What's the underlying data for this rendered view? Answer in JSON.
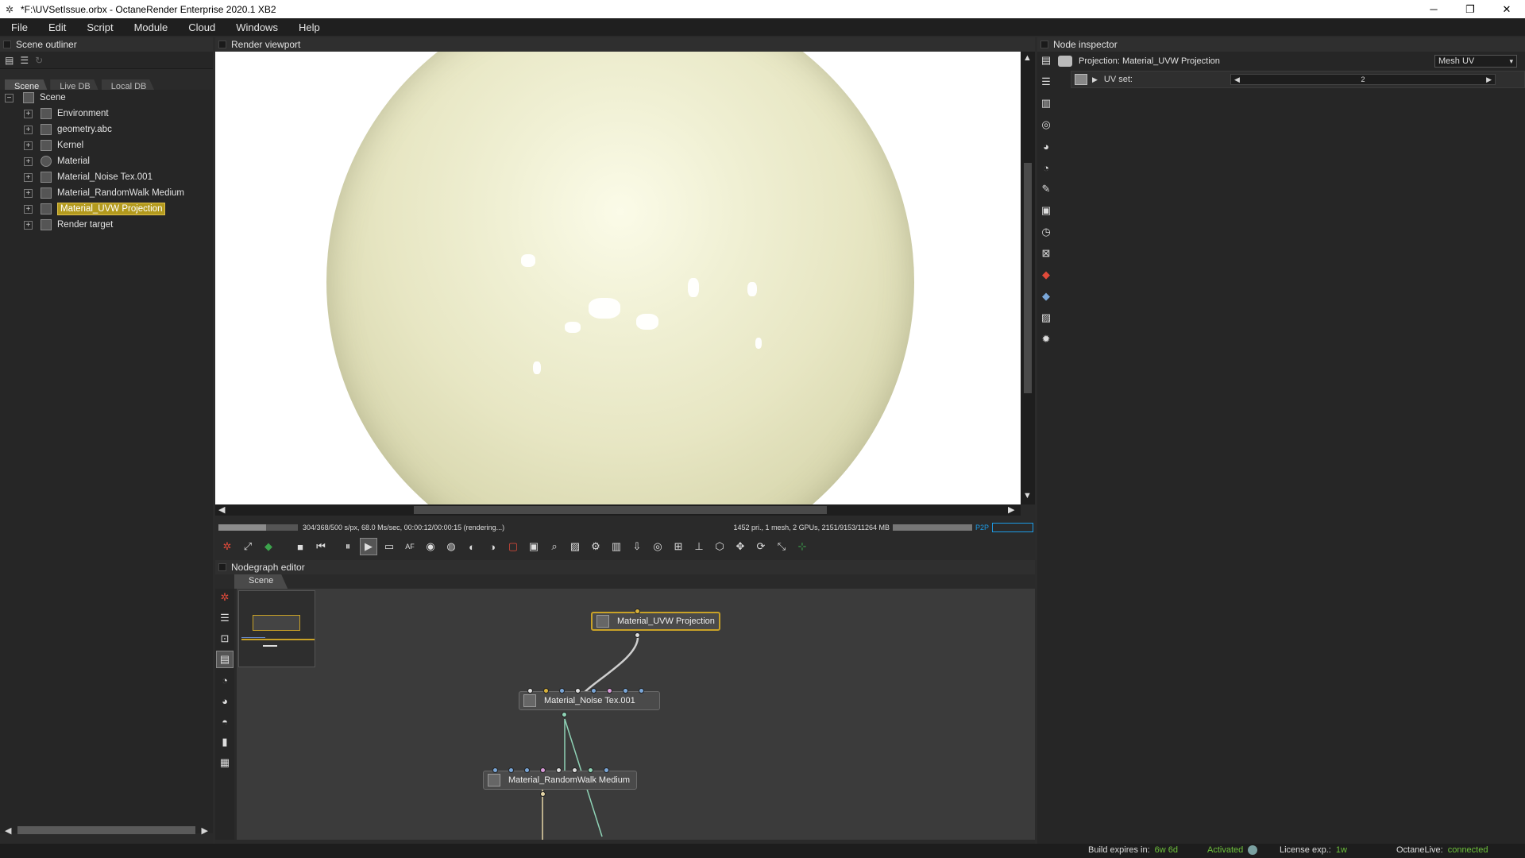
{
  "window": {
    "title": "*F:\\UVSetIssue.orbx - OctaneRender Enterprise 2020.1 XB2",
    "controls": [
      "minimize",
      "restore",
      "close"
    ]
  },
  "menu": [
    "File",
    "Edit",
    "Script",
    "Module",
    "Cloud",
    "Windows",
    "Help"
  ],
  "scene_outliner": {
    "header": "Scene outliner",
    "tabs": [
      "Scene",
      "Live DB",
      "Local DB"
    ],
    "active_tab": "Scene",
    "tree": {
      "root": "Scene",
      "items": [
        {
          "label": "Environment",
          "icon": "environment-icon"
        },
        {
          "label": "geometry.abc",
          "icon": "geometry-icon"
        },
        {
          "label": "Kernel",
          "icon": "kernel-icon"
        },
        {
          "label": "Material",
          "icon": "material-icon"
        },
        {
          "label": "Material_Noise Tex.001",
          "icon": "texture-icon"
        },
        {
          "label": "Material_RandomWalk Medium",
          "icon": "medium-icon"
        },
        {
          "label": "Material_UVW Projection",
          "icon": "projection-icon",
          "selected": true
        },
        {
          "label": "Render target",
          "icon": "render-target-icon"
        }
      ]
    }
  },
  "render_viewport": {
    "header": "Render viewport",
    "status_left": "304/368/500 s/px, 68.0 Ms/sec, 00:00:12/00:00:15 (rendering...)",
    "status_right": "1452 pri., 1 mesh, 2 GPUs, 2151/9153/11264 MB",
    "p2p_label": "P2P"
  },
  "nodegraph": {
    "header": "Nodegraph editor",
    "tab": "Scene",
    "nodes": [
      {
        "label": "Material_UVW Projection",
        "selected": true
      },
      {
        "label": "Material_Noise Tex.001"
      },
      {
        "label": "Material_RandomWalk Medium"
      }
    ]
  },
  "node_inspector": {
    "header": "Node inspector",
    "projection_label": "Projection: Material_UVW Projection",
    "projection_type": "Mesh UV",
    "uv_set_label": "UV set:",
    "uv_set_value": "2"
  },
  "statusbar": {
    "build_label": "Build expires in:",
    "build_value": "6w 6d",
    "activated": "Activated",
    "license_label": "License exp.:",
    "license_value": "1w",
    "live_label": "OctaneLive:",
    "live_value": "connected"
  },
  "colors": {
    "selection": "#b39a1e",
    "accent_blue": "#1c9be6",
    "status_green": "#6ec23b"
  }
}
